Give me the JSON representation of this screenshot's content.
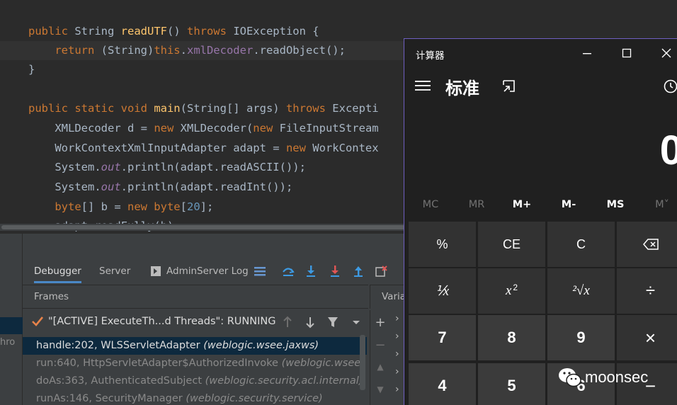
{
  "editor": {
    "lines": [
      {
        "parts": [
          [
            "kw",
            "public "
          ],
          [
            "",
            "String "
          ],
          [
            "fn",
            "readUTF"
          ],
          [
            "",
            "() "
          ],
          [
            "kw",
            "throws "
          ],
          [
            "",
            "IOException {"
          ]
        ]
      },
      {
        "parts": [
          [
            "",
            "    "
          ],
          [
            "kw",
            "return "
          ],
          [
            "",
            "(String)"
          ],
          [
            "kw",
            "this"
          ],
          [
            "",
            "."
          ],
          [
            "fld",
            "xmlDecoder"
          ],
          [
            "",
            ".readObject();"
          ]
        ]
      },
      {
        "parts": [
          [
            "",
            "}"
          ]
        ]
      },
      {
        "parts": [
          [
            "",
            ""
          ]
        ]
      },
      {
        "parts": [
          [
            "kw",
            "public static void "
          ],
          [
            "fn",
            "main"
          ],
          [
            "",
            "(String[] args) "
          ],
          [
            "kw",
            "throws "
          ],
          [
            "",
            "Excepti"
          ]
        ]
      },
      {
        "parts": [
          [
            "",
            "    XMLDecoder d = "
          ],
          [
            "kw",
            "new "
          ],
          [
            "",
            "XMLDecoder("
          ],
          [
            "kw",
            "new "
          ],
          [
            "",
            "FileInputStream"
          ]
        ]
      },
      {
        "parts": [
          [
            "",
            "    WorkContextXmlInputAdapter adapt = "
          ],
          [
            "kw",
            "new "
          ],
          [
            "",
            "WorkContex"
          ]
        ]
      },
      {
        "parts": [
          [
            "",
            "    System."
          ],
          [
            "ital",
            "out"
          ],
          [
            "",
            ".println(adapt.readASCII());"
          ]
        ]
      },
      {
        "parts": [
          [
            "",
            "    System."
          ],
          [
            "ital",
            "out"
          ],
          [
            "",
            ".println(adapt.readInt());"
          ]
        ]
      },
      {
        "parts": [
          [
            "",
            "    "
          ],
          [
            "kw",
            "byte"
          ],
          [
            "",
            "[] b = "
          ],
          [
            "kw",
            "new byte"
          ],
          [
            "",
            "["
          ],
          [
            "num",
            "20"
          ],
          [
            "",
            "];"
          ]
        ]
      },
      {
        "parts": [
          [
            "",
            "    adapt.readFully(b);"
          ]
        ]
      }
    ]
  },
  "debugger": {
    "left_strip_text": "hro",
    "tabs": [
      "Debugger",
      "Server",
      "AdminServer Log"
    ],
    "frames_label": "Frames",
    "variables_label": "Varia",
    "thread": "\"[ACTIVE] ExecuteTh...d Threads\": RUNNING",
    "frames": [
      {
        "method": "handle:202, WLSServletAdapter ",
        "pkg": "(weblogic.wsee.jaxws)"
      },
      {
        "method": "run:640, HttpServletAdapter$AuthorizedInvoke ",
        "pkg": "(weblogic.wsee."
      },
      {
        "method": "doAs:363, AuthenticatedSubject ",
        "pkg": "(weblogic.security.acl.internal)"
      },
      {
        "method": "runAs:146, SecurityManager ",
        "pkg": "(weblogic.security.service)"
      }
    ]
  },
  "calculator": {
    "title": "计算器",
    "mode": "标准",
    "display": "0",
    "memory": [
      "MC",
      "MR",
      "M+",
      "M-",
      "MS",
      "M˅"
    ],
    "keys_row1": [
      "%",
      "CE",
      "C"
    ],
    "keys_digits_r1": [
      "7",
      "8",
      "9"
    ],
    "keys_digits_r2": [
      "4",
      "5",
      "6"
    ],
    "frac_label": "⅟x",
    "sq_label": "x",
    "sq_sup": "2",
    "root_label": "²√x",
    "div_label": "÷",
    "mul_label": "×",
    "minus_label": "−"
  },
  "watermark": "moonsec"
}
